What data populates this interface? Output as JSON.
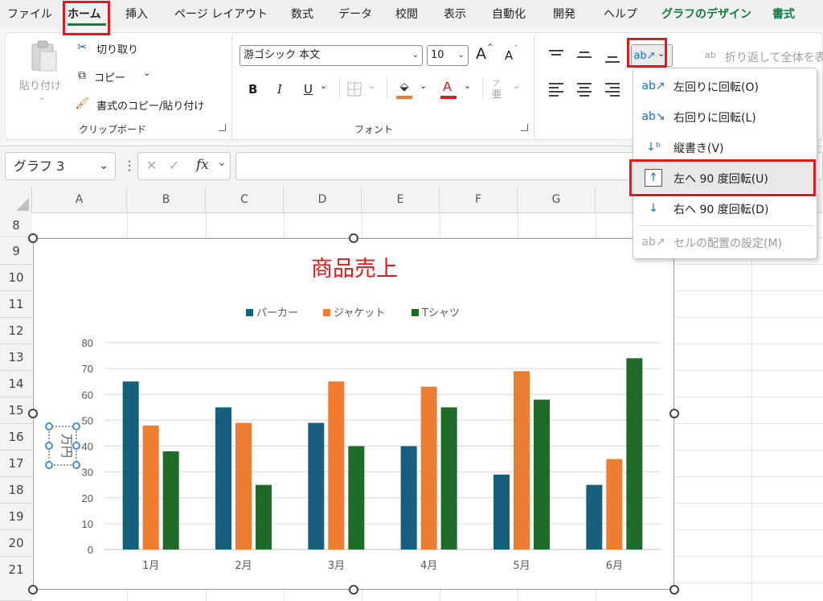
{
  "menu": {
    "tabs": [
      "ファイル",
      "ホーム",
      "挿入",
      "ページ レイアウト",
      "数式",
      "データ",
      "校閲",
      "表示",
      "自動化",
      "開発",
      "ヘルプ",
      "グラフのデザイン",
      "書式"
    ]
  },
  "clipboard": {
    "paste": "貼り付け",
    "cut": "切り取り",
    "copy": "コピー",
    "format_painter": "書式のコピー/貼り付け",
    "group_label": "クリップボード"
  },
  "font": {
    "name": "游ゴシック 本文",
    "size": "10",
    "bold": "B",
    "italic": "I",
    "underline": "U",
    "font_color_glyph": "A",
    "grow_glyph": "A",
    "shrink_glyph": "A",
    "phonetic_top": "ア",
    "phonetic_bottom": "亜",
    "group_label": "フォント",
    "fill_color": "#ed7d31",
    "text_color": "#e0191c"
  },
  "alignment": {
    "wrap_glyph": "ab",
    "wrap": "折り返して全体を表"
  },
  "formula_bar": {
    "name_box": "グラフ 3",
    "fx": "fx",
    "cancel": "✕",
    "enter": "✓"
  },
  "columns": [
    "A",
    "B",
    "C",
    "D",
    "E",
    "F",
    "G"
  ],
  "rows": [
    "8",
    "9",
    "10",
    "11",
    "12",
    "13",
    "14",
    "15",
    "16",
    "17",
    "18",
    "19",
    "20",
    "21"
  ],
  "orientation_menu": {
    "items": [
      {
        "label": "左回りに回転(O)",
        "icon": "angle-ccw-icon"
      },
      {
        "label": "右回りに回転(L)",
        "icon": "angle-cw-icon"
      },
      {
        "label": "縦書き(V)",
        "icon": "vertical-text-icon"
      },
      {
        "label": "左へ 90 度回転(U)",
        "icon": "rotate-up-icon"
      },
      {
        "label": "右へ 90 度回転(D)",
        "icon": "rotate-down-icon"
      },
      {
        "label": "セルの配置の設定(M)",
        "icon": "format-alignment-icon"
      }
    ],
    "disabled_index": 5,
    "highlighted_index": 3
  },
  "chart_data": {
    "type": "bar",
    "title": "商品売上",
    "ylabel": "万円",
    "xlabel": "",
    "categories": [
      "1月",
      "2月",
      "3月",
      "4月",
      "5月",
      "6月"
    ],
    "series": [
      {
        "name": "パーカー",
        "color": "#17607d",
        "values": [
          65,
          55,
          49,
          40,
          29,
          25
        ]
      },
      {
        "name": "ジャケット",
        "color": "#ed7d31",
        "values": [
          48,
          49,
          65,
          63,
          69,
          35
        ]
      },
      {
        "name": "Tシャツ",
        "color": "#1e6b2a",
        "values": [
          38,
          25,
          40,
          55,
          58,
          74
        ]
      }
    ],
    "ylim": [
      0,
      80
    ],
    "yticks": [
      "0",
      "10",
      "20",
      "30",
      "40",
      "50",
      "60",
      "70",
      "80"
    ],
    "grid": true,
    "legend": "top",
    "title_color": "#e0191c"
  },
  "colors": {
    "highlight": "#e0191c",
    "accent_green": "#107c41"
  }
}
